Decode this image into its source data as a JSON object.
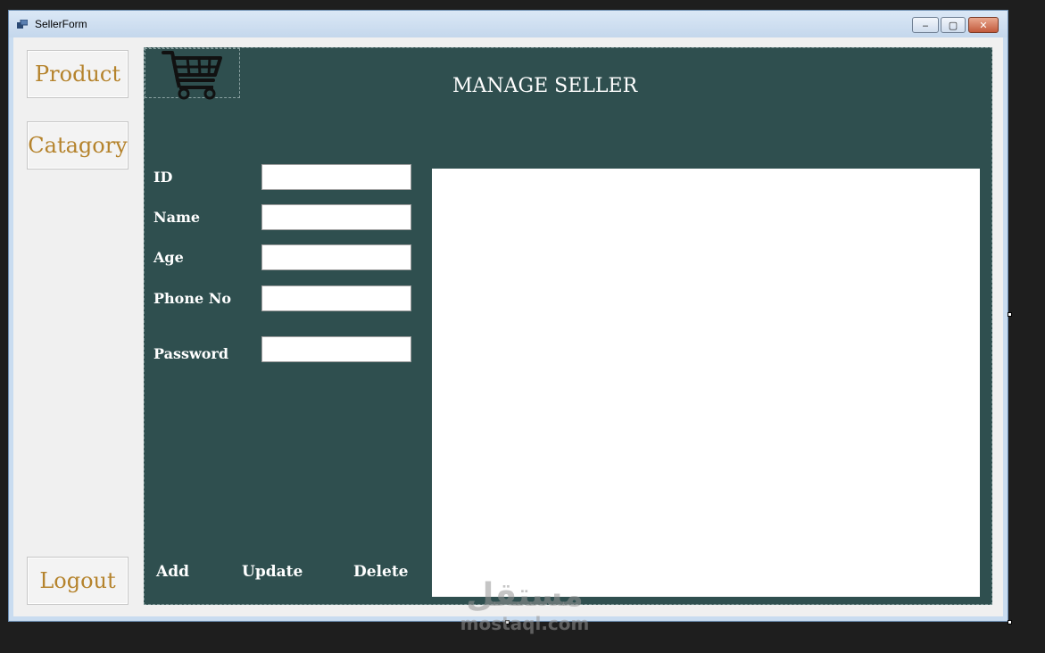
{
  "window": {
    "title": "SellerForm",
    "controls": {
      "minimize": "‒",
      "maximize": "▢",
      "close": "✕"
    }
  },
  "sidebar": {
    "items": [
      {
        "label": "Product"
      },
      {
        "label": "Catagory"
      },
      {
        "label": "Logout"
      }
    ]
  },
  "main": {
    "heading": "MANAGE SELLER",
    "cart_icon": "shopping-cart-icon",
    "fields": [
      {
        "label": "ID",
        "value": ""
      },
      {
        "label": "Name",
        "value": ""
      },
      {
        "label": "Age",
        "value": ""
      },
      {
        "label": "Phone No",
        "value": ""
      },
      {
        "label": "Password",
        "value": ""
      }
    ],
    "actions": {
      "add": "Add",
      "update": "Update",
      "delete": "Delete"
    }
  },
  "watermark": {
    "arabic": "مستقل",
    "latin": "mostaql.com"
  },
  "colors": {
    "panel": "#2f4f4f",
    "nav_text": "#b5832c",
    "window_chrome": "#c9dcf0"
  }
}
